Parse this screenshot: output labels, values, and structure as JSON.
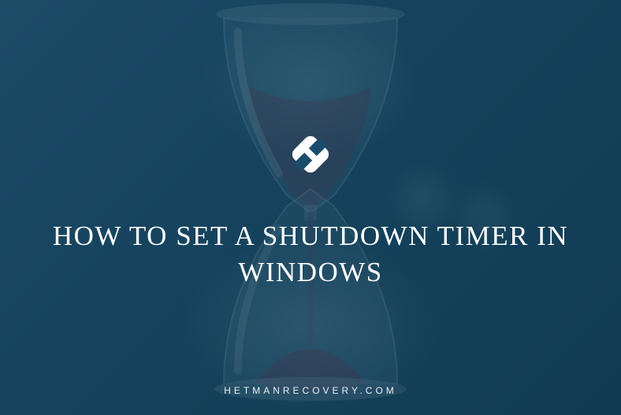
{
  "title": "HOW TO SET A SHUTDOWN TIMER IN WINDOWS",
  "footer": "HETMANRECOVERY.COM",
  "logo_name": "hetman-logo"
}
